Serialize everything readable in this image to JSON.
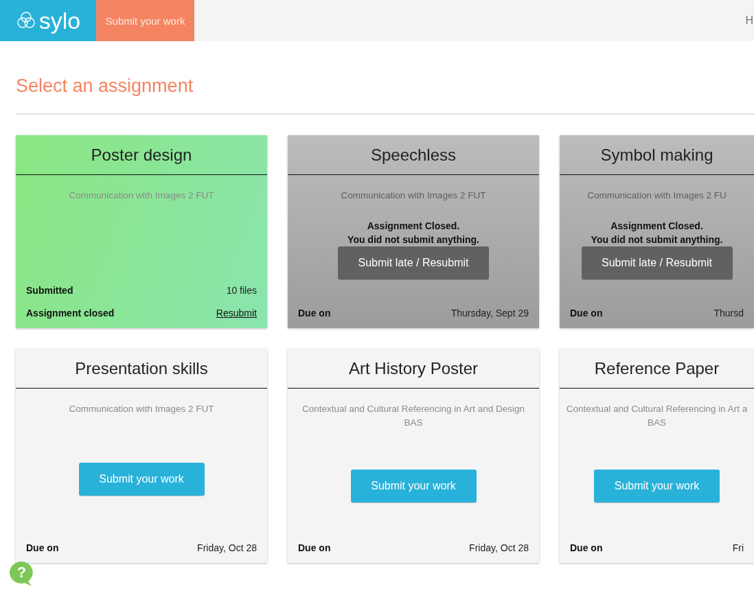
{
  "header": {
    "logo_text": "sylo",
    "nav_tab": {
      "label": "Submit your work",
      "selected": true
    },
    "right_text": "H"
  },
  "heading": "Select an assignment",
  "cards": [
    {
      "kind": "submitted",
      "title": "Poster design",
      "course": [
        "Communication with Images 2 FUT"
      ],
      "footer": [
        {
          "label": "Submitted",
          "value": "10 files",
          "link": false
        },
        {
          "label": "Assignment closed",
          "value": "Resubmit",
          "link": true
        }
      ]
    },
    {
      "kind": "closed",
      "title": "Speechless",
      "course": [
        "Communication with Images 2 FUT"
      ],
      "message": [
        "Assignment Closed.",
        "You did not submit anything."
      ],
      "button": "Submit late / Resubmit",
      "footer": [
        {
          "label": "Due on",
          "value": "Thursday, Sept 29",
          "link": false
        }
      ]
    },
    {
      "kind": "closed",
      "title": "Symbol making",
      "course": [
        "Communication with Images 2 FU"
      ],
      "message": [
        "Assignment Closed.",
        "You did not submit anything."
      ],
      "button": "Submit late / Resubmit",
      "footer": [
        {
          "label": "Due on",
          "value": "Thursd",
          "link": false
        }
      ]
    },
    {
      "kind": "open",
      "title": "Presentation skills",
      "course": [
        "Communication with Images 2 FUT"
      ],
      "button": "Submit your work",
      "footer": [
        {
          "label": "Due on",
          "value": "Friday, Oct 28",
          "link": false
        }
      ]
    },
    {
      "kind": "open",
      "title": "Art History Poster",
      "course": [
        "Contextual and Cultural Referencing in Art and Design",
        "BAS"
      ],
      "button": "Submit your work",
      "footer": [
        {
          "label": "Due on",
          "value": "Friday, Oct 28",
          "link": false
        }
      ]
    },
    {
      "kind": "open",
      "title": "Reference Paper",
      "course": [
        "Contextual and Cultural Referencing in Art a",
        "BAS"
      ],
      "button": "Submit your work",
      "footer": [
        {
          "label": "Due on",
          "value": "Fri",
          "link": false
        }
      ]
    }
  ],
  "help": {
    "label": "?"
  }
}
